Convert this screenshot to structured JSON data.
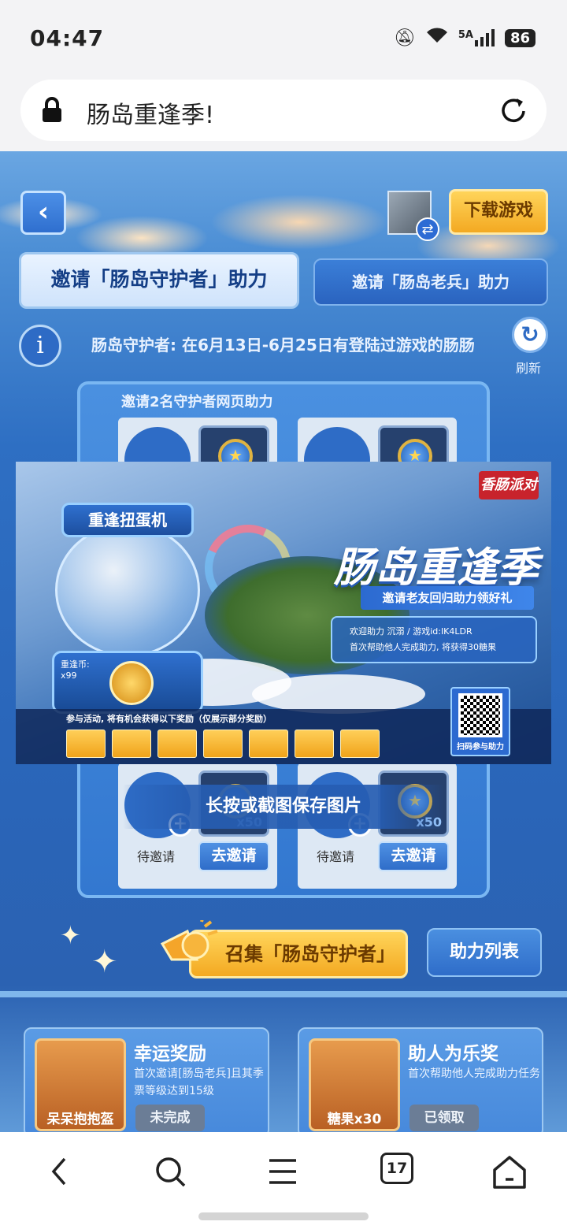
{
  "status_bar": {
    "time": "04:47",
    "network": "5A",
    "battery": "86"
  },
  "browser": {
    "page_title": "肠岛重逢季!",
    "tabs_count": "17"
  },
  "header": {
    "download_label": "下载游戏"
  },
  "tabs": [
    {
      "label": "邀请「肠岛守护者」助力",
      "active": true
    },
    {
      "label": "邀请「肠岛老兵」助力",
      "active": false
    }
  ],
  "info": {
    "description": "肠岛守护者: 在6月13日-6月25日有登陆过游戏的肠肠",
    "refresh_label": "刷新"
  },
  "invite_panel": {
    "title": "邀请2名守护者网页助力",
    "slots": [
      {
        "status": "待邀请",
        "reward_qty": "x50",
        "invite_label": "去邀请"
      },
      {
        "status": "待邀请",
        "reward_qty": "x50",
        "invite_label": "去邀请"
      }
    ]
  },
  "poster": {
    "brand": "香肠派对",
    "machine_label": "重逢扭蛋机",
    "machine_counter_label": "重逢币:",
    "machine_counter_value": "x99",
    "heading": "肠岛重逢季",
    "ribbon": "邀请老友回归助力领好礼",
    "welcome_line": "欢迎助力 沉溺 / 游戏id:IK4LDR",
    "reward_line": "首次帮助他人完成助力, 将获得30糖果",
    "rewards_caption": "参与活动, 将有机会获得以下奖励（仅展示部分奖励）",
    "prize_count": 7,
    "qr_caption": "扫码参与助力"
  },
  "save_hint": "长按或截图保存图片",
  "actions": {
    "gather_label": "召集「肠岛守护者」",
    "assist_list_label": "助力列表"
  },
  "reward_cards": [
    {
      "item_name": "呆呆抱抱盔",
      "title": "幸运奖励",
      "description": "首次邀请[肠岛老兵]且其季票等级达到15级",
      "state": "未完成"
    },
    {
      "item_name": "糖果x30",
      "title": "助人为乐奖",
      "description": "首次帮助他人完成助力任务",
      "state": "已领取"
    }
  ],
  "colors": {
    "accent_gold": "#f3a922",
    "accent_blue": "#2e6bc5",
    "page_bg": "#2b62b2"
  },
  "icons": [
    "lock-icon",
    "reload-icon",
    "back-icon",
    "info-icon",
    "refresh-icon",
    "person-icon",
    "plus-icon",
    "coin-icon",
    "megaphone-icon",
    "nav-back-icon",
    "nav-search-icon",
    "nav-menu-icon",
    "nav-home-icon"
  ]
}
